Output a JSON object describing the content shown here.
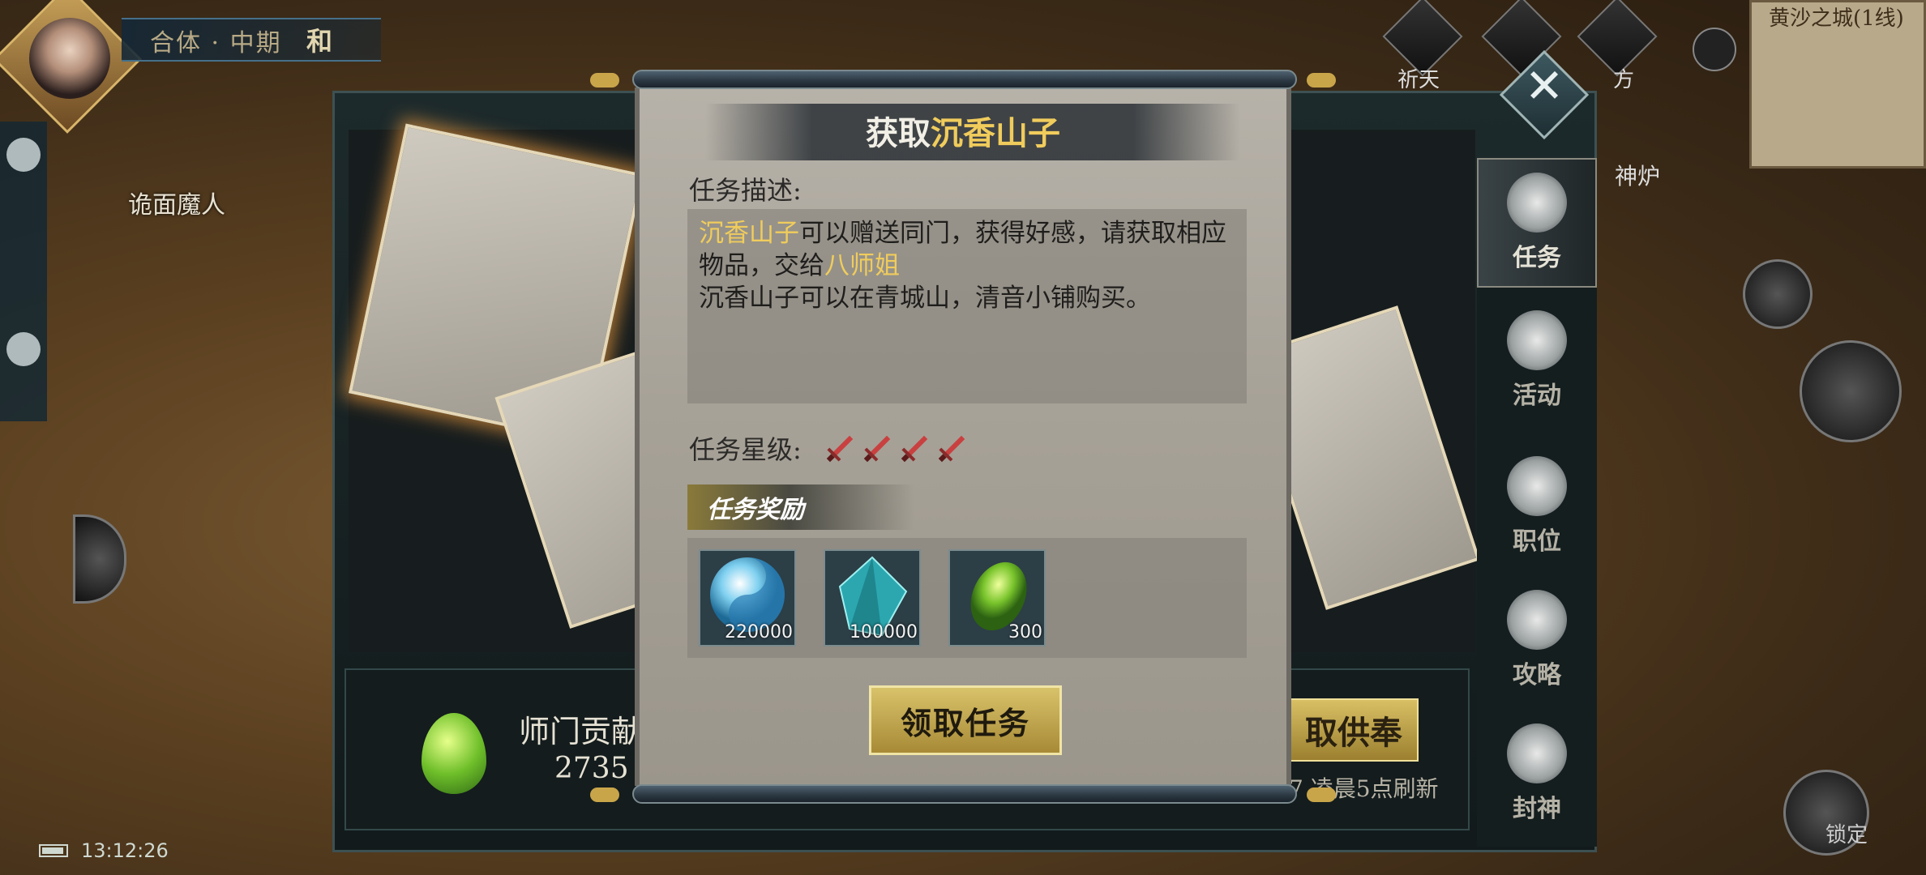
{
  "hud": {
    "realm": "合体 · 中期",
    "realm_mode": "和",
    "enemy_name": "诡面魔人",
    "time": "13:12:26",
    "map_name": "黄沙之城(1线)",
    "top_icons": [
      "祈天",
      "",
      "",
      "方"
    ],
    "right_labels": [
      "神炉",
      "锁定"
    ]
  },
  "dialog": {
    "title_prefix": "获取",
    "title_item": "沉香山子",
    "desc_label": "任务描述:",
    "desc_item": "沉香山子",
    "desc_text1": "可以赠送同门，获得好感，请获取相应物品，交给",
    "desc_npc": "八师姐",
    "desc_text2": "沉香山子可以在青城山，清音小铺购买。",
    "star_label": "任务星级:",
    "stars": 4,
    "reward_label": "任务奖励",
    "rewards": [
      {
        "icon": "yin-yang-orb-icon",
        "amount": "220000"
      },
      {
        "icon": "blue-crystal-icon",
        "amount": "100000"
      },
      {
        "icon": "green-seed-icon",
        "amount": "300"
      }
    ],
    "accept_label": "领取任务"
  },
  "panel": {
    "contribution_label": "师门贡献",
    "contribution_value": "2735",
    "offer_button": "取供奉",
    "refresh_note": "7 凌晨5点刷新"
  },
  "tabs": [
    {
      "label": "任务",
      "icon": "quest-scroll-icon",
      "active": true
    },
    {
      "label": "活动",
      "icon": "activity-icon",
      "active": false
    },
    {
      "label": "职位",
      "icon": "position-icon",
      "active": false
    },
    {
      "label": "攻略",
      "icon": "guide-cards-icon",
      "active": false
    },
    {
      "label": "封神",
      "icon": "deify-icon",
      "active": false
    }
  ],
  "colors": {
    "accent_gold": "#f0cc5c",
    "button_gold": "#d8c26a"
  }
}
